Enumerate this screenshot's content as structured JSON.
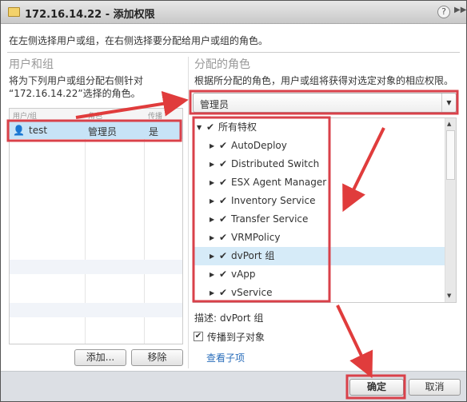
{
  "window": {
    "title": "172.16.14.22 - 添加权限",
    "help_icon": "question-circle-icon",
    "more_icon": "double-chevron-right-icon"
  },
  "intro": "在左侧选择用户或组，在右侧选择要分配给用户或组的角色。",
  "left": {
    "heading": "用户和组",
    "desc_line1": "将为下列用户或组分配右侧针对",
    "desc_line2": "“172.16.14.22”选择的角色。",
    "columns": [
      "用户/组",
      "角色",
      "传播"
    ],
    "rows": [
      {
        "user": "test",
        "role": "管理员",
        "propagate": "是",
        "selected": true
      }
    ],
    "add_button": "添加...",
    "remove_button": "移除"
  },
  "right": {
    "heading": "分配的角色",
    "desc": "根据所分配的角色，用户或组将获得对选定对象的相应权限。",
    "role_select": "管理员",
    "tree_root": "所有特权",
    "tree_items": [
      "AutoDeploy",
      "Distributed Switch",
      "ESX Agent Manager",
      "Inventory Service",
      "Transfer Service",
      "VRMPolicy",
      "dvPort 组",
      "vApp",
      "vService"
    ],
    "selected_item": "dvPort 组",
    "description_label": "描述:",
    "description_value": "dvPort 组",
    "propagate_label": "传播到子对象",
    "propagate_checked": true,
    "view_children_link": "查看子项"
  },
  "footer": {
    "ok": "确定",
    "cancel": "取消"
  },
  "colors": {
    "annotation": "#e03c3c",
    "selection": "#c7e3f7",
    "link": "#2a6ebb"
  }
}
